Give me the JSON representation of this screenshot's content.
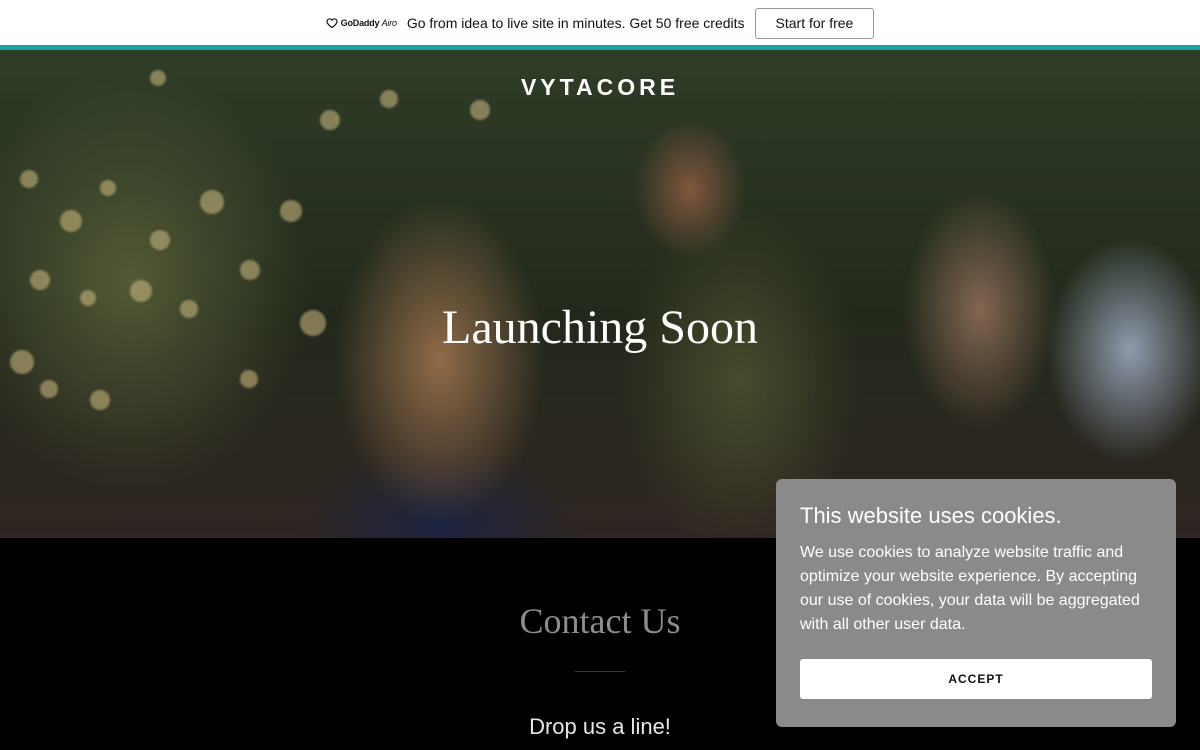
{
  "promo": {
    "brand_name": "GoDaddy",
    "brand_suffix": "Airo",
    "message": "Go from idea to live site in minutes. Get 50 free credits",
    "cta_label": "Start for free",
    "accent_color": "#1aa5a5"
  },
  "hero": {
    "site_name": "VYTACORE",
    "headline": "Launching Soon"
  },
  "contact": {
    "title": "Contact Us",
    "subtitle": "Drop us a line!"
  },
  "cookie_banner": {
    "title": "This website uses cookies.",
    "body": "We use cookies to analyze website traffic and optimize your website experience. By accepting our use of cookies, your data will be aggregated with all other user data.",
    "accept_label": "ACCEPT",
    "background_color": "#8a8a8a"
  },
  "icons": {
    "brand": "godaddy-heart-icon"
  }
}
